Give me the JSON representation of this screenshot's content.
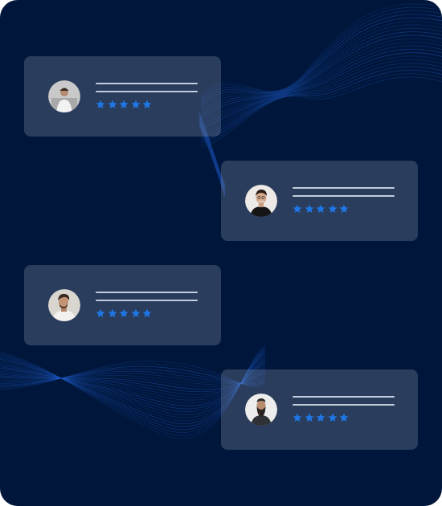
{
  "colors": {
    "background": "#00163A",
    "wave": "#1E5BC8",
    "line": "#C2CCDD",
    "star": "#1F77E6"
  },
  "icons": {
    "rating": "star-icon",
    "avatar": "user-avatar-photo"
  },
  "testimonials": [
    {
      "id": "reviewer-1",
      "rating": 5,
      "rating_max": 5,
      "avatar_style": "light-gray"
    },
    {
      "id": "reviewer-2",
      "rating": 5,
      "rating_max": 5,
      "avatar_style": "dark-shirt"
    },
    {
      "id": "reviewer-3",
      "rating": 5,
      "rating_max": 5,
      "avatar_style": "white-shirt"
    },
    {
      "id": "reviewer-4",
      "rating": 5,
      "rating_max": 5,
      "avatar_style": "bearded"
    }
  ]
}
